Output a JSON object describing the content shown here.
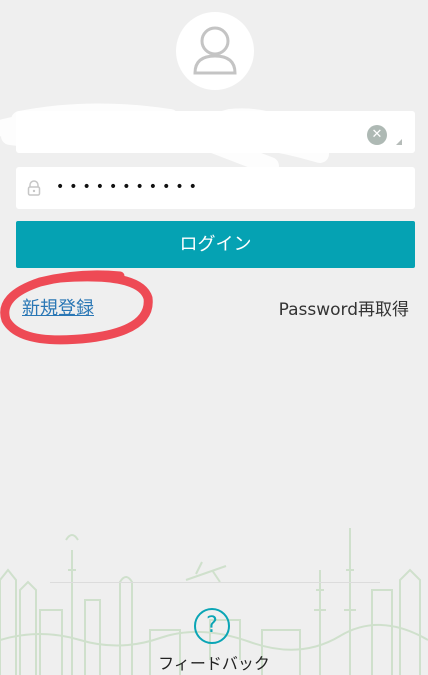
{
  "login_form": {
    "username_value": "",
    "password_value": "•••••••••••",
    "clear_glyph": "✕",
    "login_label": "ログイン"
  },
  "links": {
    "signup": "新規登録",
    "password_reset": "Password再取得"
  },
  "feedback": {
    "icon_glyph": "?",
    "label": "フィードバック"
  },
  "colors": {
    "accent": "#05a2b3",
    "link": "#2a77b5",
    "annotation": "#ee4a55",
    "background": "#efefef"
  },
  "icons": {
    "avatar": "user-silhouette-icon",
    "clear": "clear-x-icon",
    "lock": "lock-icon",
    "feedback": "question-mark-icon"
  }
}
